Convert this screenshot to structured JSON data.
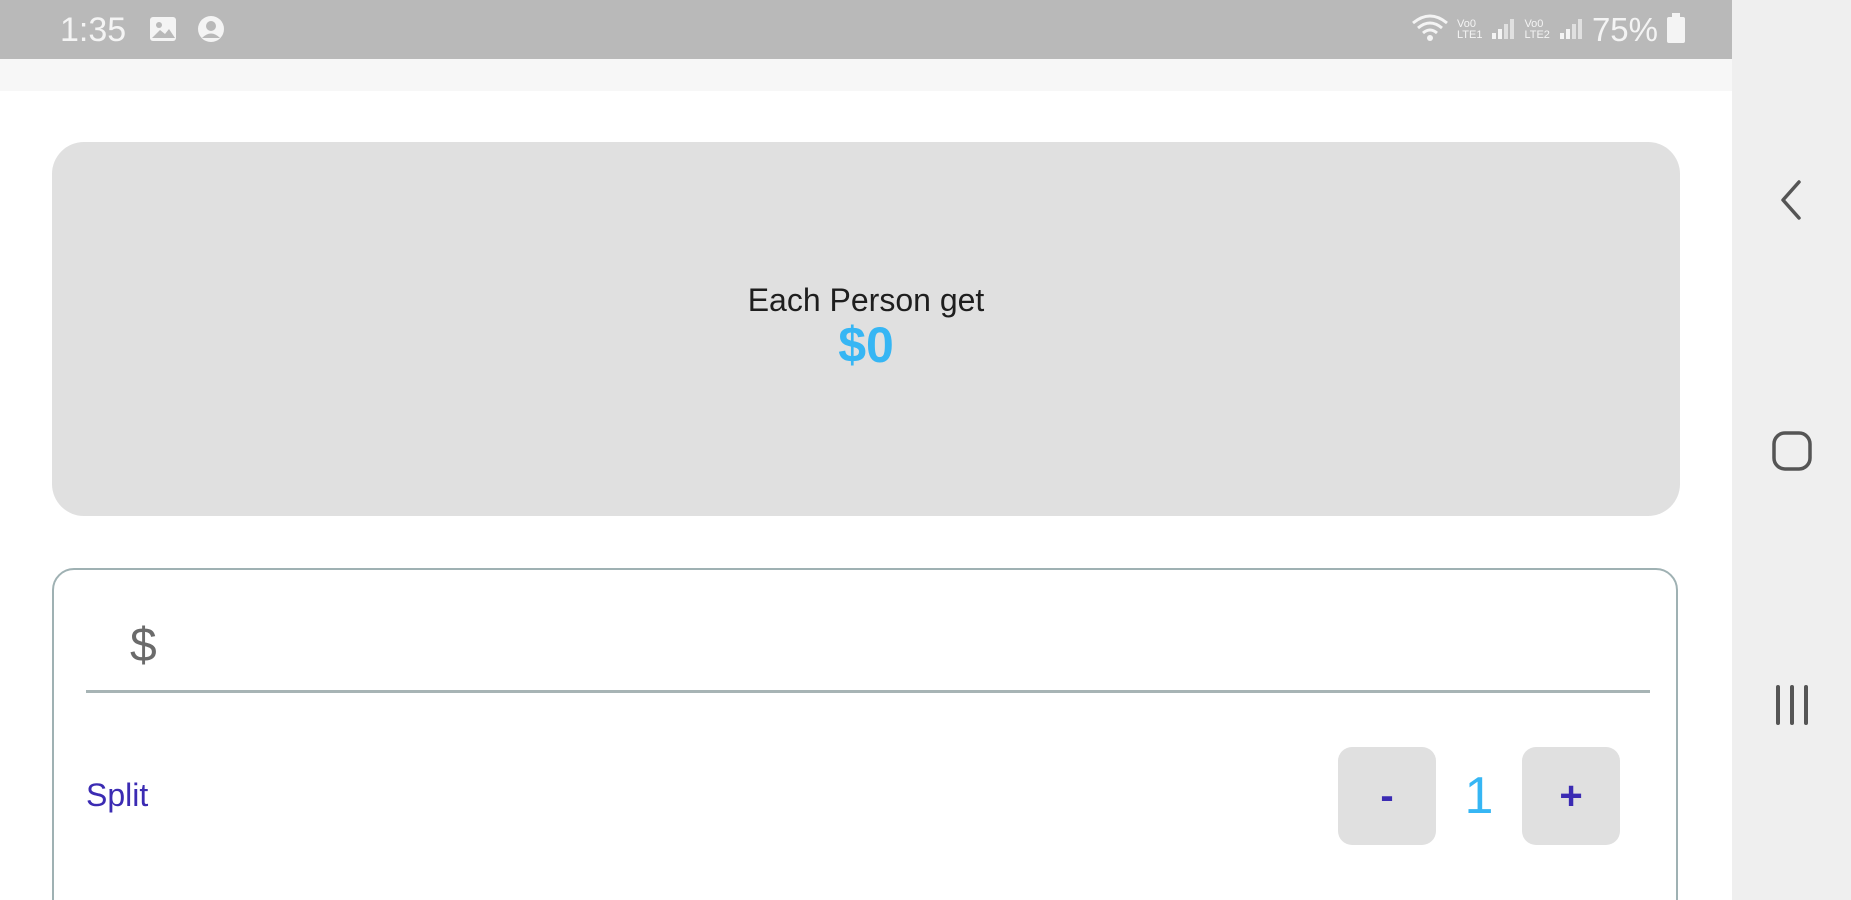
{
  "status_bar": {
    "time": "1:35",
    "battery": "75%",
    "sim1_label": "Vo0\nLTE1",
    "sim2_label": "Vo0\nLTE2",
    "icons": [
      "image-icon",
      "account-circle-icon",
      "wifi-icon",
      "signal-icon",
      "battery-icon"
    ]
  },
  "result": {
    "label": "Each Person get",
    "value": "$0"
  },
  "amount": {
    "prefix": "$",
    "value": "",
    "placeholder": ""
  },
  "split": {
    "label": "Split",
    "minus_label": "-",
    "plus_label": "+",
    "count": "1"
  },
  "nav": {
    "icons": [
      "back-icon",
      "home-icon",
      "recents-icon"
    ]
  },
  "colors": {
    "accent_blue": "#36b6f4",
    "accent_purple": "#3b2bb3",
    "card_gray": "#e0e0e0",
    "status_bar_gray": "#b9b9b9"
  }
}
